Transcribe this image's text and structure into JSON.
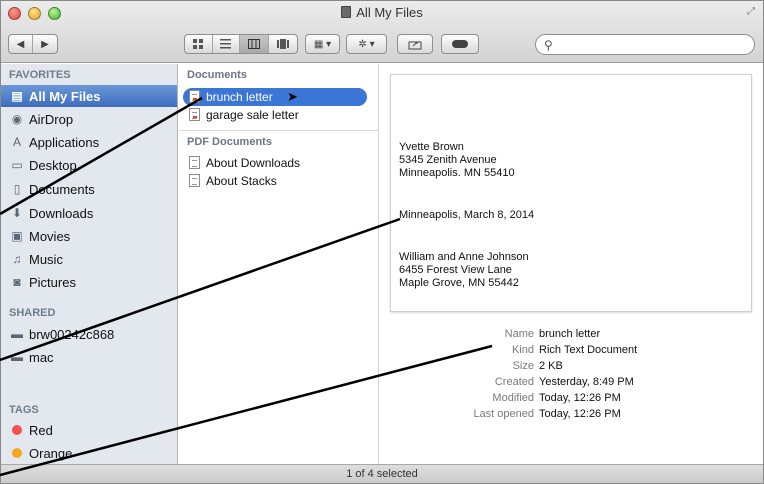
{
  "window": {
    "title": "All My Files",
    "status": "1 of 4 selected"
  },
  "toolbar": {
    "back_icon": "back-arrow-icon",
    "forward_icon": "forward-arrow-icon",
    "view_modes": [
      "icon-view",
      "list-view",
      "column-view",
      "coverflow-view"
    ],
    "active_view": "column-view",
    "search": {
      "value": "",
      "placeholder": ""
    }
  },
  "sidebar": {
    "favorites_header": "FAVORITES",
    "favorites": [
      {
        "label": "All My Files",
        "icon": "all-my-files-icon",
        "selected": true
      },
      {
        "label": "AirDrop",
        "icon": "airdrop-icon"
      },
      {
        "label": "Applications",
        "icon": "applications-icon"
      },
      {
        "label": "Desktop",
        "icon": "desktop-icon"
      },
      {
        "label": "Documents",
        "icon": "documents-icon"
      },
      {
        "label": "Downloads",
        "icon": "downloads-icon"
      },
      {
        "label": "Movies",
        "icon": "movies-icon"
      },
      {
        "label": "Music",
        "icon": "music-icon"
      },
      {
        "label": "Pictures",
        "icon": "pictures-icon"
      }
    ],
    "shared_header": "SHARED",
    "shared": [
      {
        "label": "brw00242c868",
        "icon": "computer-icon"
      },
      {
        "label": "mac",
        "icon": "computer-icon"
      }
    ],
    "tags_header": "TAGS",
    "tags": [
      {
        "label": "Red",
        "color": "#f0524f"
      },
      {
        "label": "Orange",
        "color": "#f5a623"
      }
    ]
  },
  "files": {
    "documents_header": "Documents",
    "documents": [
      "brunch letter",
      "garage sale letter"
    ],
    "pdf_header": "PDF Documents",
    "pdfs": [
      "About Downloads",
      "About Stacks"
    ]
  },
  "preview": {
    "sender": [
      "Yvette Brown",
      "5345 Zenith Avenue",
      "Minneapolis. MN 55410"
    ],
    "dateline": "Minneapolis, March 8, 2014",
    "recipient": [
      "William and Anne Johnson",
      "6455 Forest View Lane",
      "Maple Grove, MN 55442"
    ],
    "info": [
      {
        "key": "Name",
        "value": "brunch letter"
      },
      {
        "key": "Kind",
        "value": "Rich Text Document"
      },
      {
        "key": "Size",
        "value": "2 KB"
      },
      {
        "key": "Created",
        "value": "Yesterday, 8:49 PM"
      },
      {
        "key": "Modified",
        "value": "Today, 12:26 PM"
      },
      {
        "key": "Last opened",
        "value": "Today, 12:26 PM"
      }
    ]
  }
}
